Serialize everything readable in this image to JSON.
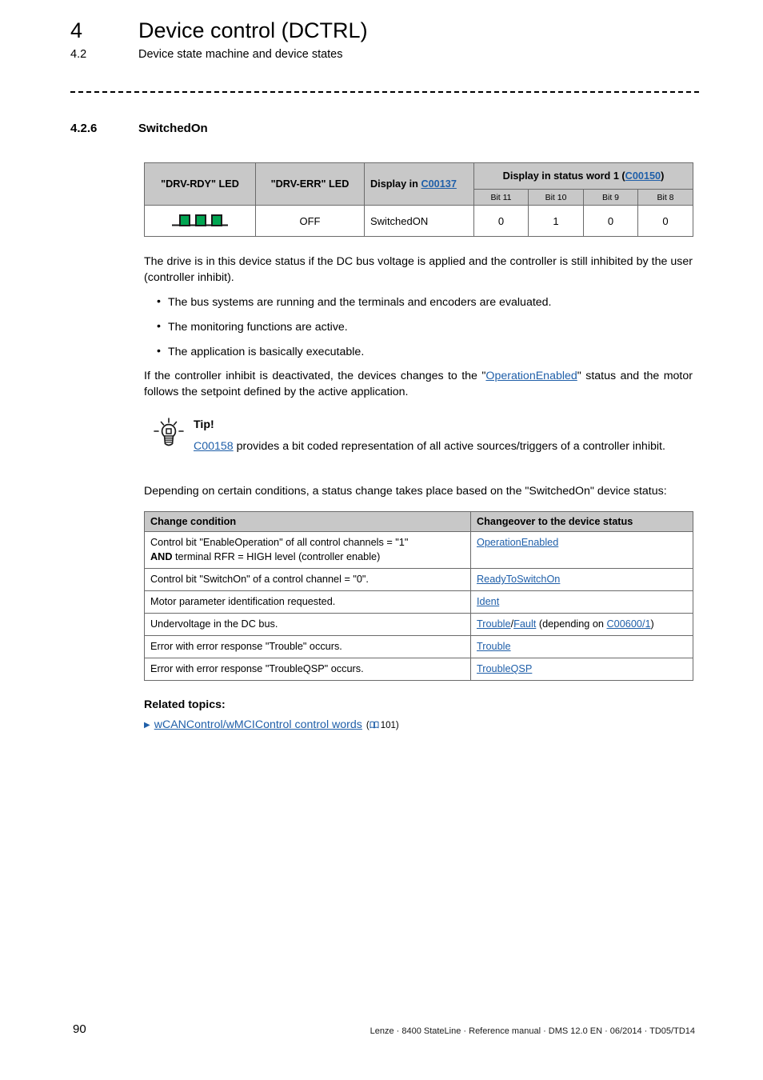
{
  "running_header": {
    "chapter_number": "4",
    "chapter_title": "Device control (DCTRL)",
    "section_number": "4.2",
    "section_title": "Device state machine and device states"
  },
  "section": {
    "number": "4.2.6",
    "title": "SwitchedOn"
  },
  "status_table": {
    "headers": {
      "drv_rdy": "\"DRV-RDY\" LED",
      "drv_err": "\"DRV-ERR\" LED",
      "display_in_label": "Display in ",
      "display_in_code": "C00137",
      "status_word_label": "Display in status word 1 (",
      "status_word_code": "C00150",
      "status_word_label_end": ")"
    },
    "bit_headers": [
      "Bit 11",
      "Bit 10",
      "Bit 9",
      "Bit 8"
    ],
    "row": {
      "drv_rdy_icon": "led-blink-3-pulse-icon",
      "drv_err": "OFF",
      "display_in": "SwitchedON",
      "bits": [
        "0",
        "1",
        "0",
        "0"
      ]
    },
    "led_color": "#00a551"
  },
  "intro": {
    "paragraph": "The drive is in this device status if the DC bus voltage is applied and the controller is still inhibited by the user (controller inhibit).",
    "bullets": [
      "The bus systems are running and the terminals and encoders are evaluated.",
      "The monitoring functions are active.",
      "The application is basically executable."
    ],
    "after_bullets_part1": "If the controller inhibit is deactivated, the devices changes to the \"",
    "after_bullets_link": "OperationEnabled",
    "after_bullets_part2": "\" status and the motor follows the setpoint defined by the active application."
  },
  "tip": {
    "icon": "lightbulb-icon",
    "title": "Tip!",
    "body_link": "C00158",
    "body_text": " provides a bit coded representation of all active sources/triggers of a controller inhibit."
  },
  "lead_in": "Depending on certain conditions, a status change takes place based on the \"SwitchedOn\" device status:",
  "change_table": {
    "headers": [
      "Change condition",
      "Changeover to the device status"
    ],
    "rows": [
      {
        "condition_line1": "Control bit \"EnableOperation\" of all control channels = \"1\"",
        "condition_bold": "AND",
        "condition_line2": " terminal RFR = HIGH level (controller enable)",
        "target_link": "OperationEnabled"
      },
      {
        "condition_line1": "Control bit \"SwitchOn\" of a control channel = \"0\".",
        "target_link": "ReadyToSwitchOn"
      },
      {
        "condition_line1": "Motor parameter identification requested.",
        "target_link": "Ident"
      },
      {
        "condition_line1": "Undervoltage in the DC bus.",
        "target_link": "Trouble",
        "target_sep": "/",
        "target_link2": "Fault",
        "target_mid": " (depending on ",
        "target_link3": "C00600/1",
        "target_end": ")"
      },
      {
        "condition_line1": "Error with error response \"Trouble\" occurs.",
        "target_link": "Trouble"
      },
      {
        "condition_line1": "Error with error response \"TroubleQSP\" occurs.",
        "target_link": "TroubleQSP"
      }
    ]
  },
  "related": {
    "title": "Related topics:",
    "items": [
      {
        "marker": "triangle-right-icon",
        "link": "wCANControl/wMCIControl control words",
        "page_icon": "book-icon",
        "page_open": "(",
        "page_number": "101",
        "page_close": ")"
      }
    ]
  },
  "footer": {
    "page_number": "90",
    "text": "Lenze · 8400 StateLine · Reference manual · DMS 12.0 EN · 06/2014 · TD05/TD14"
  }
}
